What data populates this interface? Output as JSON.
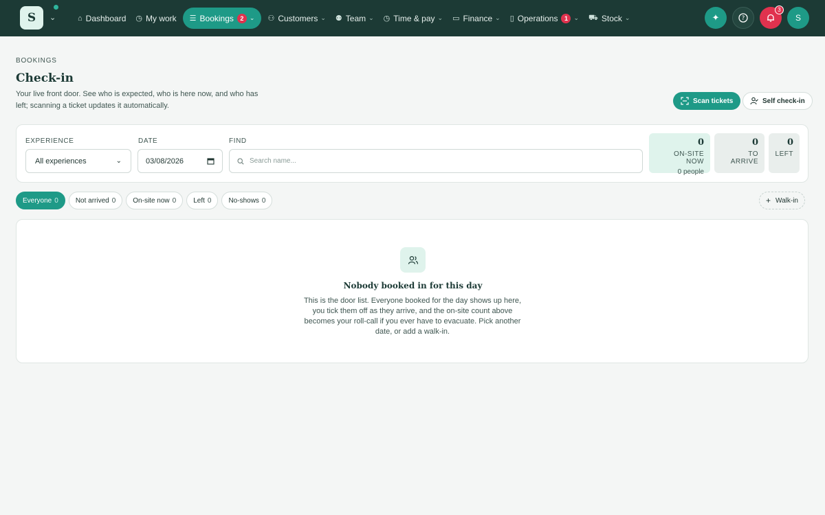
{
  "brand": {
    "logo_letter": "S"
  },
  "nav": {
    "items": [
      {
        "label": "Dashboard",
        "icon": "home-icon"
      },
      {
        "label": "My work",
        "icon": "clock-icon"
      },
      {
        "label": "Bookings",
        "icon": "list-icon",
        "badge": "2",
        "active": true
      },
      {
        "label": "Customers",
        "icon": "users-icon"
      },
      {
        "label": "Team",
        "icon": "team-icon"
      },
      {
        "label": "Time & pay",
        "icon": "clock-icon"
      },
      {
        "label": "Finance",
        "icon": "card-icon"
      },
      {
        "label": "Operations",
        "icon": "clipboard-icon",
        "badge": "1"
      },
      {
        "label": "Stock",
        "icon": "cart-icon"
      }
    ],
    "notification_count": "3",
    "avatar_letter": "S"
  },
  "header": {
    "eyebrow": "BOOKINGS",
    "title": "Check-in",
    "description": "Your live front door. See who is expected, who is here now, and who has left; scanning a ticket updates it automatically.",
    "scan_label": "Scan tickets",
    "self_checkin_label": "Self check-in"
  },
  "filters": {
    "experience_label": "EXPERIENCE",
    "experience_value": "All experiences",
    "date_label": "DATE",
    "date_value": "03/08/2026",
    "find_label": "FIND",
    "search_placeholder": "Search name..."
  },
  "stats": {
    "onsite": {
      "value": "0",
      "label": "ON-SITE NOW",
      "sub": "0 people"
    },
    "arrive": {
      "value": "0",
      "label": "TO ARRIVE"
    },
    "left": {
      "value": "0",
      "label": "LEFT"
    }
  },
  "pills": [
    {
      "label": "Everyone",
      "count": "0",
      "active": true
    },
    {
      "label": "Not arrived",
      "count": "0"
    },
    {
      "label": "On-site now",
      "count": "0"
    },
    {
      "label": "Left",
      "count": "0"
    },
    {
      "label": "No-shows",
      "count": "0"
    }
  ],
  "walkin_label": "Walk-in",
  "empty": {
    "title": "Nobody booked in for this day",
    "description": "This is the door list. Everyone booked for the day shows up here, you tick them off as they arrive, and the on-site count above becomes your roll-call if you ever have to evacuate. Pick another date, or add a walk-in."
  },
  "colors": {
    "nav_bg": "#1c3a35",
    "accent": "#1e9a87",
    "danger": "#e0324e",
    "onsite_bg": "#dff3ec"
  }
}
